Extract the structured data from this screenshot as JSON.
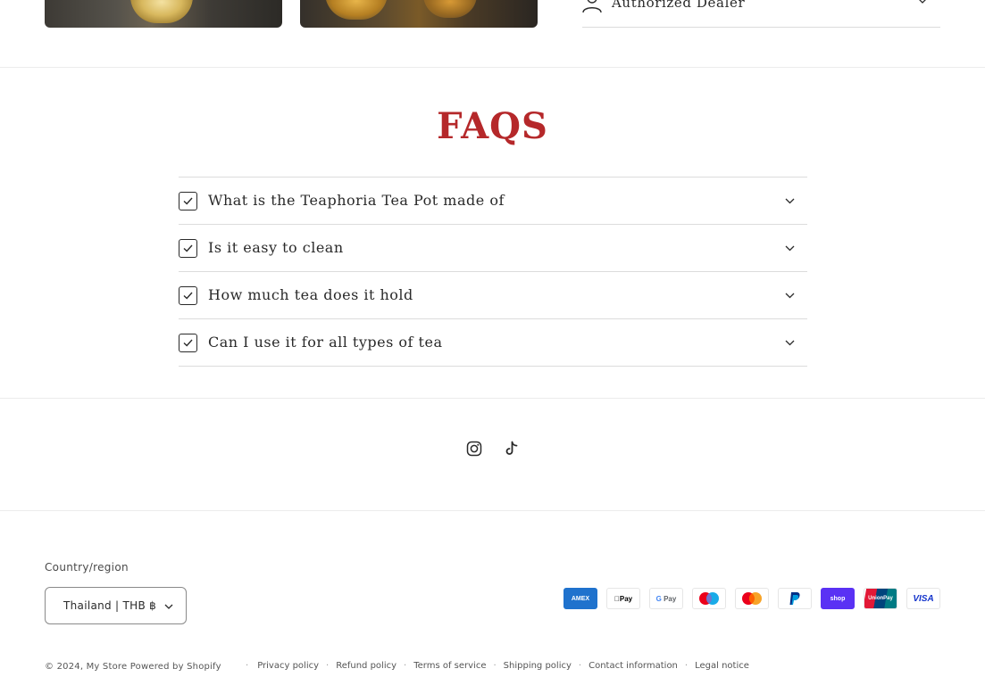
{
  "top": {
    "authorized_dealer_label": "Authorized Dealer"
  },
  "faq": {
    "title": "FAQS",
    "items": [
      {
        "question": "What is the Teaphoria Tea Pot made of"
      },
      {
        "question": "Is it easy to clean"
      },
      {
        "question": "How much tea does it hold"
      },
      {
        "question": "Can I use it for all types of tea"
      }
    ]
  },
  "footer": {
    "social": [
      "Instagram",
      "TikTok"
    ],
    "country_label": "Country/region",
    "country_value": "Thailand | THB ฿",
    "payment_methods": [
      {
        "name": "American Express",
        "icon": "amex-icon",
        "color": "#1f72cd"
      },
      {
        "name": "Apple Pay",
        "icon": "apple-pay-icon",
        "color": "#000000"
      },
      {
        "name": "Google Pay",
        "icon": "google-pay-icon",
        "color": "#5f6368"
      },
      {
        "name": "Maestro",
        "icon": "maestro-icon",
        "color": "#eb001b"
      },
      {
        "name": "Mastercard",
        "icon": "mastercard-icon",
        "color": "#f79e1b"
      },
      {
        "name": "PayPal",
        "icon": "paypal-icon",
        "color": "#003087"
      },
      {
        "name": "Shop Pay",
        "icon": "shop-pay-icon",
        "color": "#5a31f4"
      },
      {
        "name": "Union Pay",
        "icon": "union-pay-icon",
        "color": "#e21836"
      },
      {
        "name": "Visa",
        "icon": "visa-icon",
        "color": "#1434cb"
      }
    ],
    "copyright_prefix": "© 2024,",
    "store_name": "My Store",
    "powered_by": "Powered by Shopify",
    "policy_links": [
      "Privacy policy",
      "Refund policy",
      "Terms of service",
      "Shipping policy",
      "Contact information",
      "Legal notice"
    ],
    "separator": "·"
  }
}
